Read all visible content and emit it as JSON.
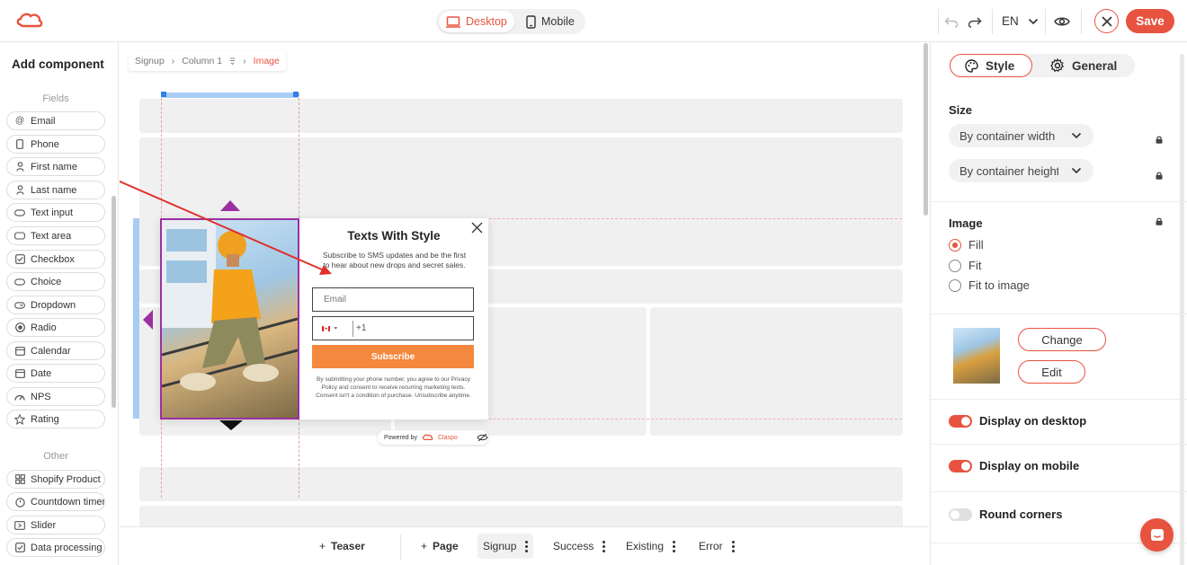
{
  "header": {
    "device_desktop": "Desktop",
    "device_mobile": "Mobile",
    "language": "EN",
    "save_label": "Save",
    "accent": "#e8533f"
  },
  "left_panel": {
    "title": "Add component",
    "fields_heading": "Fields",
    "fields": [
      {
        "label": "Email",
        "icon": "at-icon"
      },
      {
        "label": "Phone",
        "icon": "phone-icon"
      },
      {
        "label": "First name",
        "icon": "person-icon"
      },
      {
        "label": "Last name",
        "icon": "person-icon"
      },
      {
        "label": "Text input",
        "icon": "input-icon"
      },
      {
        "label": "Text area",
        "icon": "textarea-icon"
      },
      {
        "label": "Checkbox",
        "icon": "checkbox-icon"
      },
      {
        "label": "Choice",
        "icon": "choice-icon"
      },
      {
        "label": "Dropdown",
        "icon": "dropdown-icon"
      },
      {
        "label": "Radio",
        "icon": "radio-icon"
      },
      {
        "label": "Calendar",
        "icon": "calendar-icon"
      },
      {
        "label": "Date",
        "icon": "date-icon"
      },
      {
        "label": "NPS",
        "icon": "gauge-icon"
      },
      {
        "label": "Rating",
        "icon": "star-icon"
      }
    ],
    "other_heading": "Other",
    "other": [
      {
        "label": "Shopify Product",
        "icon": "grid-icon"
      },
      {
        "label": "Countdown timer",
        "icon": "timer-icon"
      },
      {
        "label": "Slider",
        "icon": "slider-icon"
      },
      {
        "label": "Data processing",
        "icon": "checkbox-icon"
      }
    ]
  },
  "breadcrumb": {
    "items": [
      "Signup",
      "Column 1",
      "Image"
    ]
  },
  "popup": {
    "title": "Texts With Style",
    "subtitle": "Subscribe to SMS updates and be the first to hear about new drops and secret sales.",
    "email_placeholder": "Email",
    "phone_code": "+1",
    "subscribe_label": "Subscribe",
    "legal": "By submitting your phone number, you agree to our Privacy Policy and consent to receive recurring marketing texts. Consent isn't a condition of purchase. Unsubscribe anytime.",
    "powered_by": "Powered by",
    "brand": "Claspo"
  },
  "bottom_bar": {
    "add_teaser": "Teaser",
    "add_page": "Page",
    "pages": [
      "Signup",
      "Success",
      "Existing",
      "Error"
    ],
    "active_page": "Signup"
  },
  "right_panel": {
    "tab_style": "Style",
    "tab_general": "General",
    "size_heading": "Size",
    "width_select": "By container width",
    "height_select": "By container height",
    "image_heading": "Image",
    "image_options": [
      "Fill",
      "Fit",
      "Fit to image"
    ],
    "image_selected": "Fill",
    "change_label": "Change",
    "edit_label": "Edit",
    "display_desktop": "Display on desktop",
    "display_desktop_on": true,
    "display_mobile": "Display on mobile",
    "display_mobile_on": true,
    "round_corners": "Round corners",
    "round_corners_on": false
  }
}
